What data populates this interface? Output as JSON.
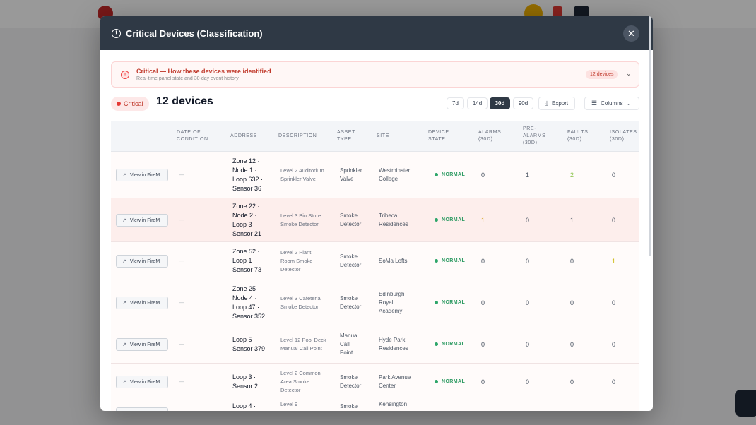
{
  "modal": {
    "title": "Critical Devices (Classification)",
    "close_symbol": "✕",
    "info_symbol": "!"
  },
  "banner": {
    "title": "Critical — How these devices were identified",
    "subtitle": "Real-time panel state and 30-day event history",
    "badge": "12 devices",
    "chevron": "⌄"
  },
  "toolbar": {
    "status_label": "Critical",
    "count_label": "12 devices",
    "ranges": [
      "7d",
      "14d",
      "30d",
      "90d"
    ],
    "active_range": "30d",
    "export_label": "Export",
    "columns_label": "Columns"
  },
  "table": {
    "headers": {
      "date": "DATE OF CONDITION",
      "address": "ADDRESS",
      "description": "DESCRIPTION",
      "asset_type": "ASSET TYPE",
      "site": "SITE",
      "device_state": "DEVICE STATE",
      "alarms": "ALARMS (30D)",
      "pre_alarms": "PRE-ALARMS (30D)",
      "faults": "FAULTS (30D)",
      "isolates": "ISOLATES (30D)"
    },
    "view_label": "View in FireM",
    "rows": [
      {
        "date": "—",
        "address": "Zone 12 · Node 1 · Loop 632 · Sensor 36",
        "description": "Level 2 Auditorium Sprinkler Valve",
        "asset_type": "Sprinkler Valve",
        "site": "Westminster College",
        "state": "NORMAL",
        "alarms": "0",
        "pre_alarms": "1",
        "faults": "2",
        "isolates": "0"
      },
      {
        "date": "—",
        "address": "Zone 22 · Node 2 · Loop 3 · Sensor 21",
        "description": "Level 3 Bin Store Smoke Detector",
        "asset_type": "Smoke Detector",
        "site": "Tribeca Residences",
        "state": "NORMAL",
        "alarms": "1",
        "pre_alarms": "0",
        "faults": "1",
        "isolates": "0"
      },
      {
        "date": "—",
        "address": "Zone 52 · Loop 1 · Sensor 73",
        "description": "Level 2 Plant Room Smoke Detector",
        "asset_type": "Smoke Detector",
        "site": "SoMa Lofts",
        "state": "NORMAL",
        "alarms": "0",
        "pre_alarms": "0",
        "faults": "0",
        "isolates": "1"
      },
      {
        "date": "—",
        "address": "Zone 25 · Node 4 · Loop 47 · Sensor 352",
        "description": "Level 3 Cafeteria Smoke Detector",
        "asset_type": "Smoke Detector",
        "site": "Edinburgh Royal Academy",
        "state": "NORMAL",
        "alarms": "0",
        "pre_alarms": "0",
        "faults": "0",
        "isolates": "0"
      },
      {
        "date": "—",
        "address": "Loop 5 · Sensor 379",
        "description": "Level 12 Pool Deck Manual Call Point",
        "asset_type": "Manual Call Point",
        "site": "Hyde Park Residences",
        "state": "NORMAL",
        "alarms": "0",
        "pre_alarms": "0",
        "faults": "0",
        "isolates": "0"
      },
      {
        "date": "—",
        "address": "Loop 3 · Sensor 2",
        "description": "Level 2 Common Area Smoke Detector",
        "asset_type": "Smoke Detector",
        "site": "Park Avenue Center",
        "state": "NORMAL",
        "alarms": "0",
        "pre_alarms": "0",
        "faults": "0",
        "isolates": "0"
      },
      {
        "date": "",
        "address": "Loop 4 ·",
        "description": "Level 9",
        "asset_type": "Smoke",
        "site": "Kensington",
        "state": "",
        "alarms": "",
        "pre_alarms": "",
        "faults": "",
        "isolates": ""
      }
    ]
  },
  "colors": {
    "header_bg": "#2f3945",
    "critical": "#c0392b",
    "normal_state": "#2e9b63"
  },
  "icons": [
    "info-icon",
    "close-icon",
    "alert-icon",
    "chevron-down-icon",
    "download-icon",
    "columns-icon",
    "external-link-icon"
  ]
}
